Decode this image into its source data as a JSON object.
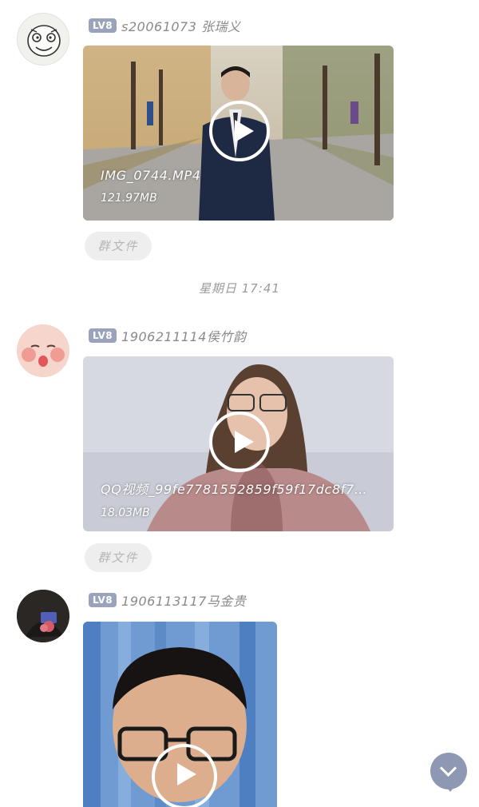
{
  "messages": [
    {
      "level": "LV8",
      "sender": "s20061073 张瑞义",
      "file_name": "IMG_0744.MP4",
      "file_size": "121.97MB",
      "tag": "群文件",
      "avatar_icon": "meme-face-avatar"
    },
    {
      "level": "LV8",
      "sender": "1906211114侯竹韵",
      "file_name": "QQ视频_99fe7781552859f59f17dc8f7…",
      "file_size": "18.03MB",
      "tag": "群文件",
      "avatar_icon": "baby-face-avatar"
    },
    {
      "level": "LV8",
      "sender": "1906113117马金贵",
      "avatar_icon": "dark-photo-avatar"
    }
  ],
  "timestamp": "星期日 17:41",
  "scroll_button_icon": "chevron-down-icon",
  "colors": {
    "level_badge": "#9aa3bb",
    "scroll_button": "#8f98b2",
    "tag_background": "#eeeeee"
  }
}
